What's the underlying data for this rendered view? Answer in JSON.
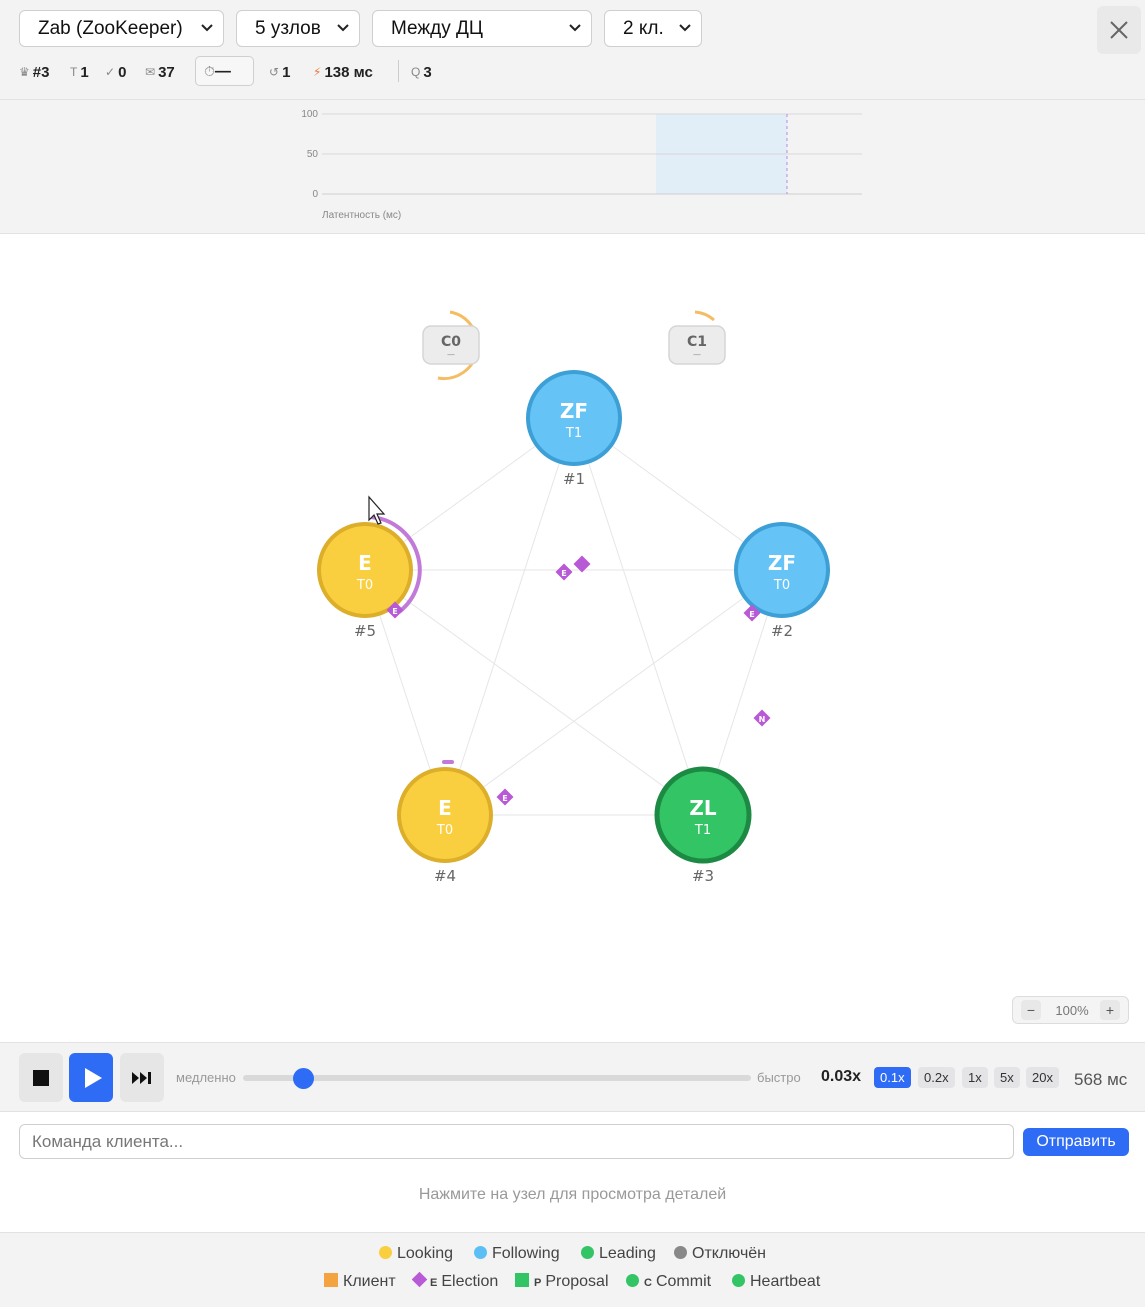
{
  "header": {
    "protocol_select": "Zab (ZooKeeper)",
    "nodes_select": "5 узлов",
    "network_select": "Между ДЦ",
    "clients_select": "2 кл."
  },
  "stats": {
    "leader": "#3",
    "term": "1",
    "committed": "0",
    "messages": "37",
    "timer": "—",
    "restarts": "1",
    "latency": "138 мс",
    "quorum": "3"
  },
  "latency_chart": {
    "chart_data": {
      "type": "area",
      "title": "",
      "xlabel": "Латентность (мс)",
      "ylabel": "",
      "yticks": [
        "100",
        "50",
        "0"
      ],
      "ylim": [
        0,
        100
      ],
      "series": [],
      "highlight_band": "current window"
    }
  },
  "graph": {
    "nodes": [
      {
        "id": "#1",
        "state": "ZF",
        "term": "T1",
        "color": "#5bbff5"
      },
      {
        "id": "#2",
        "state": "ZF",
        "term": "T0",
        "color": "#5bbff5"
      },
      {
        "id": "#3",
        "state": "ZL",
        "term": "T1",
        "color": "#33c465"
      },
      {
        "id": "#4",
        "state": "E",
        "term": "T0",
        "color": "#f9cf3f"
      },
      {
        "id": "#5",
        "state": "E",
        "term": "T0",
        "color": "#f9cf3f"
      }
    ],
    "clients": [
      {
        "id": "C0",
        "sub": "—"
      },
      {
        "id": "C1",
        "sub": "—"
      }
    ],
    "message_labels": [
      "E",
      "E",
      "E",
      "N",
      "E"
    ],
    "zoom": "100%"
  },
  "playback": {
    "slow_label": "медленно",
    "fast_label": "быстро",
    "speed_value": "0.03x",
    "speed_fraction": 0.12,
    "presets": [
      "0.1x",
      "0.2x",
      "1x",
      "5x",
      "20x"
    ],
    "active_preset": "0.1x",
    "sim_time": "568 мс"
  },
  "command": {
    "placeholder": "Команда клиента...",
    "send_label": "Отправить",
    "hint": "Нажмите на узел для просмотра деталей"
  },
  "legend": {
    "states": [
      {
        "label": "Looking",
        "color": "#f9cf3f"
      },
      {
        "label": "Following",
        "color": "#5bbff5"
      },
      {
        "label": "Leading",
        "color": "#33c465"
      },
      {
        "label": "Отключён",
        "color": "#888888"
      }
    ],
    "messages": [
      {
        "label": "Клиент",
        "letter": "",
        "color": "#f3a340"
      },
      {
        "label": "Election",
        "letter": "E",
        "color": "#b85ad6"
      },
      {
        "label": "Proposal",
        "letter": "P",
        "color": "#33c465"
      },
      {
        "label": "Commit",
        "letter": "C",
        "color": "#33c465"
      },
      {
        "label": "Heartbeat",
        "letter": "",
        "color": "#33c465"
      }
    ]
  }
}
